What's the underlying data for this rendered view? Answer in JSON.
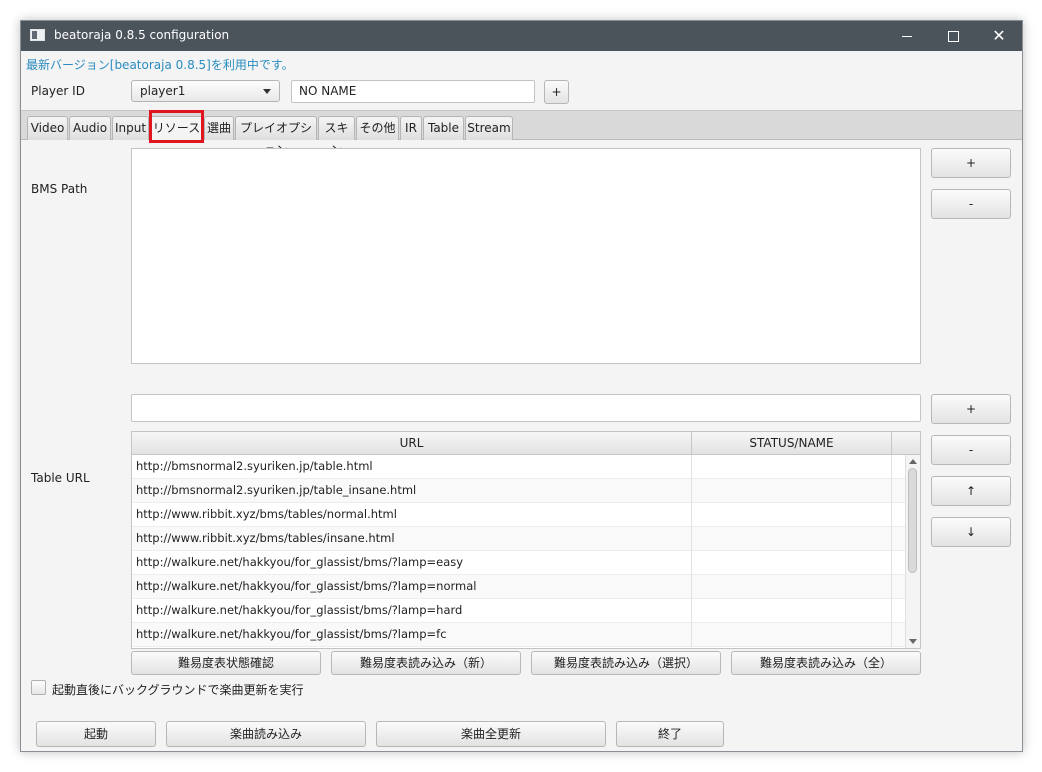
{
  "window": {
    "title": "beatoraja 0.8.5 configuration"
  },
  "notice": "最新バージョン[beatoraja 0.8.5]を利用中です。",
  "player": {
    "label": "Player ID",
    "selected": "player1",
    "name_value": "NO NAME",
    "add_label": "+"
  },
  "tabs": [
    {
      "label": "Video"
    },
    {
      "label": "Audio"
    },
    {
      "label": "Input"
    },
    {
      "label": "リソース"
    },
    {
      "label": "選曲"
    },
    {
      "label": "プレイオプション"
    },
    {
      "label": "スキン"
    },
    {
      "label": "その他"
    },
    {
      "label": "IR"
    },
    {
      "label": "Table"
    },
    {
      "label": "Stream"
    }
  ],
  "bms_path": {
    "label": "BMS Path",
    "add_label": "+",
    "remove_label": "-"
  },
  "table_url": {
    "label": "Table URL",
    "input_value": "",
    "add_label": "+",
    "remove_label": "-",
    "up_label": "↑",
    "down_label": "↓",
    "columns": {
      "url": "URL",
      "status": "STATUS/NAME"
    },
    "rows": [
      {
        "url": "http://bmsnormal2.syuriken.jp/table.html",
        "status": ""
      },
      {
        "url": "http://bmsnormal2.syuriken.jp/table_insane.html",
        "status": ""
      },
      {
        "url": "http://www.ribbit.xyz/bms/tables/normal.html",
        "status": ""
      },
      {
        "url": "http://www.ribbit.xyz/bms/tables/insane.html",
        "status": ""
      },
      {
        "url": "http://walkure.net/hakkyou/for_glassist/bms/?lamp=easy",
        "status": ""
      },
      {
        "url": "http://walkure.net/hakkyou/for_glassist/bms/?lamp=normal",
        "status": ""
      },
      {
        "url": "http://walkure.net/hakkyou/for_glassist/bms/?lamp=hard",
        "status": ""
      },
      {
        "url": "http://walkure.net/hakkyou/for_glassist/bms/?lamp=fc",
        "status": ""
      }
    ],
    "actions": {
      "check": "難易度表状態確認",
      "load_new": "難易度表読み込み（新）",
      "load_selected": "難易度表読み込み（選択）",
      "load_all": "難易度表読み込み（全）"
    }
  },
  "startup_update": {
    "label": "起動直後にバックグラウンドで楽曲更新を実行",
    "checked": false
  },
  "footer": {
    "start": "起動",
    "load_songs": "楽曲読み込み",
    "update_all": "楽曲全更新",
    "exit": "終了"
  }
}
